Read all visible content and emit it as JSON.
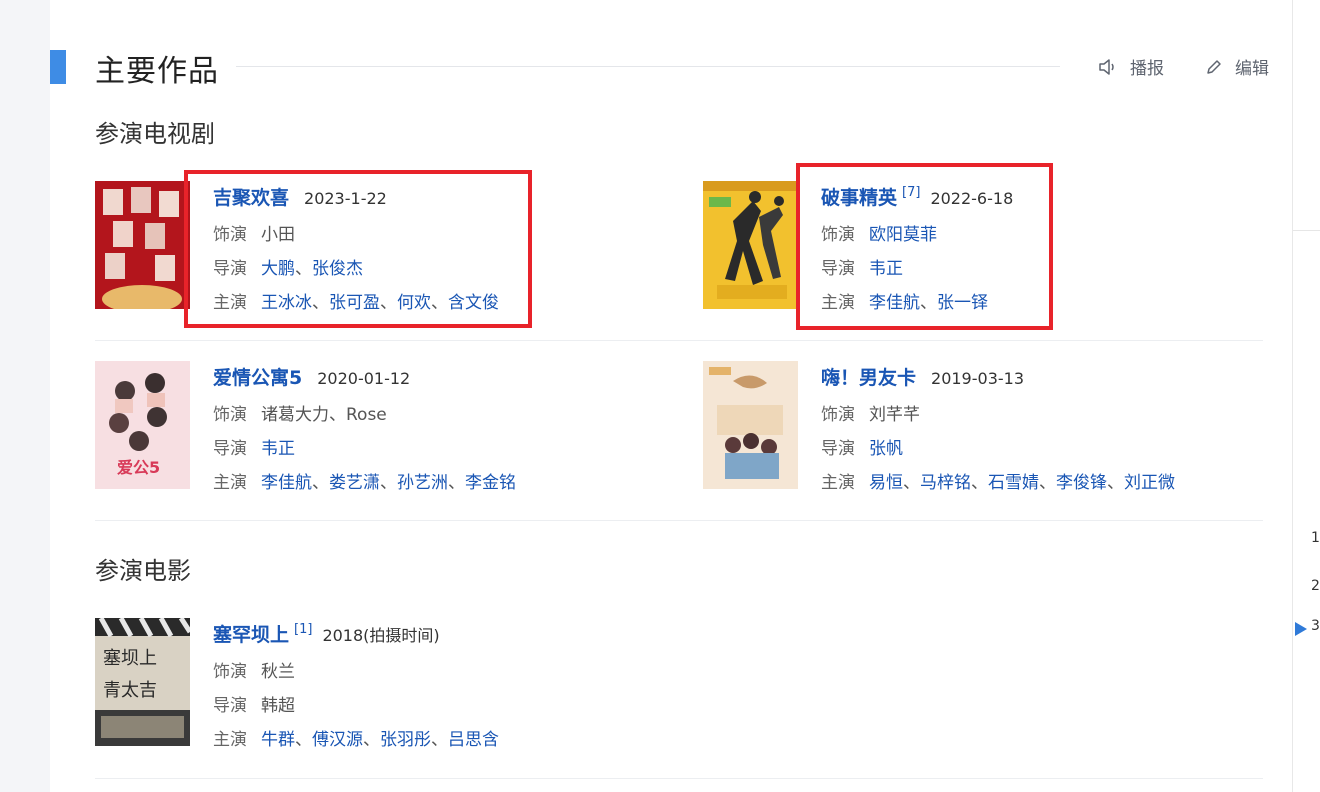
{
  "section": {
    "title": "主要作品",
    "report_label": "播报",
    "edit_label": "编辑",
    "tv_heading": "参演电视剧",
    "film_heading": "参演电影"
  },
  "labels": {
    "role": "饰演",
    "director": "导演",
    "cast": "主演",
    "sep": "、"
  },
  "tv_works": [
    {
      "title": "吉聚欢喜",
      "sup": "",
      "date": "2023-1-22",
      "role": "小田",
      "directors": [
        "大鹏",
        "张俊杰"
      ],
      "cast": [
        "王冰冰",
        "张可盈",
        "何欢",
        "含文俊"
      ],
      "highlighted": true
    },
    {
      "title": "破事精英",
      "sup": "[7]",
      "date": "2022-6-18",
      "role": "欧阳莫菲",
      "directors": [
        "韦正"
      ],
      "cast": [
        "李佳航",
        "张一铎"
      ],
      "highlighted": true
    },
    {
      "title": "爱情公寓5",
      "sup": "",
      "date": "2020-01-12",
      "role": "诸葛大力、Rose",
      "directors": [
        "韦正"
      ],
      "cast": [
        "李佳航",
        "娄艺潇",
        "孙艺洲",
        "李金铭"
      ],
      "highlighted": false
    },
    {
      "title": "嗨！男友卡",
      "sup": "",
      "date": "2019-03-13",
      "role": "刘芊芊",
      "directors": [
        "张帆"
      ],
      "cast": [
        "易恒",
        "马梓铭",
        "石雪婧",
        "李俊锋",
        "刘正微"
      ],
      "highlighted": false
    }
  ],
  "film_works": [
    {
      "title": "塞罕坝上",
      "sup": "[1]",
      "date": "2018(拍摄时间)",
      "role": "秋兰",
      "directors": [
        "韩超"
      ],
      "cast": [
        "牛群",
        "傅汉源",
        "张羽彤",
        "吕思含"
      ],
      "highlighted": false
    }
  ],
  "colors": {
    "accent": "#3e8ce5",
    "link": "#1a56b4",
    "highlight_box": "#e8232a"
  },
  "icons": [
    "speaker-icon",
    "pencil-icon",
    "expand-arrow-icon"
  ]
}
